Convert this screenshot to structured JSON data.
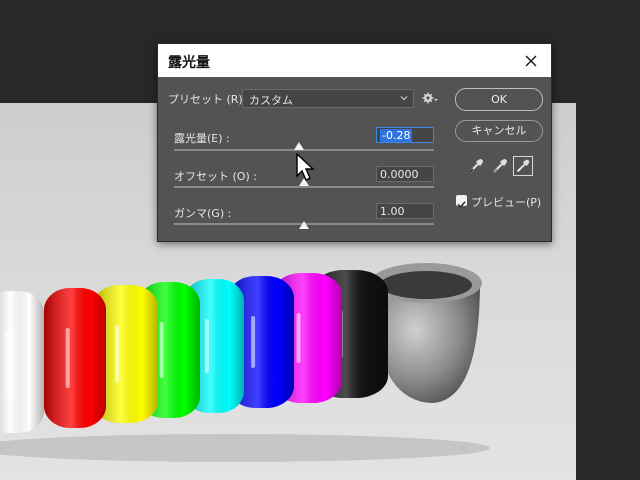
{
  "dialog": {
    "title": "露光量",
    "preset": {
      "label": "プリセット (R) :",
      "value": "カスタム"
    },
    "exposure": {
      "label": "露光量(E) :",
      "value": "-0.28"
    },
    "offset": {
      "label": "オフセット (O) :",
      "value": "0.0000"
    },
    "gamma": {
      "label": "ガンマ(G) :",
      "value": "1.00"
    },
    "buttons": {
      "ok": "OK",
      "cancel": "キャンセル"
    },
    "preview": {
      "label": "プレビュー(P)",
      "checked": true
    }
  },
  "colors": {
    "dialog_bg": "#535353",
    "accent": "#2e73e0",
    "rings": [
      "#ffffff",
      "#ff0000",
      "#ffff00",
      "#00ff00",
      "#00ffff",
      "#0000ff",
      "#ff00ff",
      "#111111"
    ]
  },
  "icons": [
    "close-icon",
    "chevron-down-icon",
    "gear-icon",
    "eyedropper-black-icon",
    "eyedropper-gray-icon",
    "eyedropper-white-icon",
    "check-icon",
    "cursor-icon"
  ]
}
